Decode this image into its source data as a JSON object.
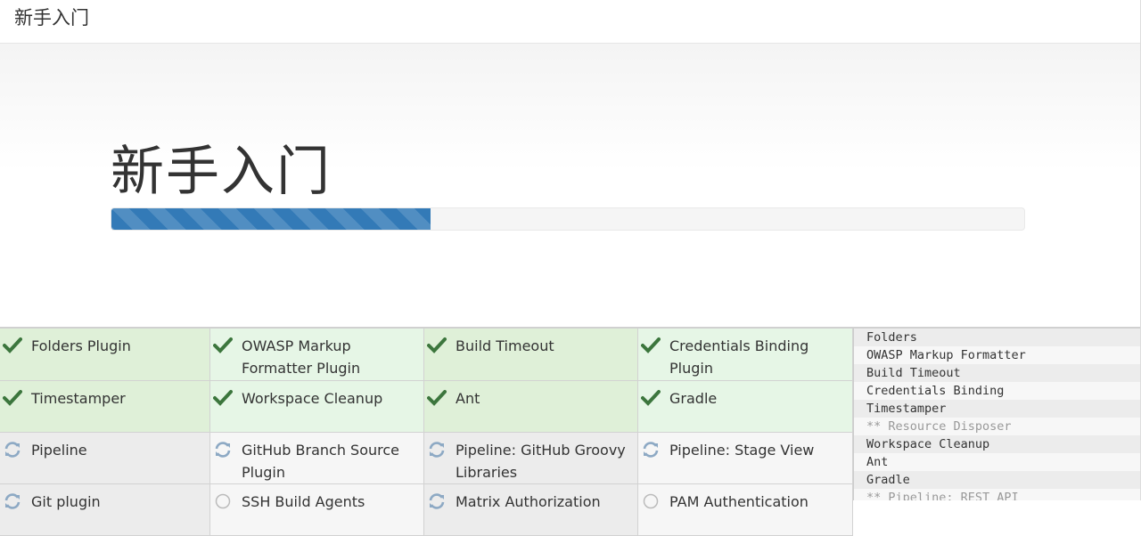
{
  "topbar": {
    "title": "新手入门"
  },
  "hero": {
    "heading": "新手入门",
    "progress_percent": 35
  },
  "colors": {
    "progress": "#337ab7",
    "installed_bg": "#dff0d8",
    "check": "#3c763d",
    "pending_bg": "#ececec",
    "spinner": "#8da9c4"
  },
  "plugins": [
    {
      "name": "Folders Plugin",
      "status": "installed"
    },
    {
      "name": "OWASP Markup Formatter Plugin",
      "status": "installed"
    },
    {
      "name": "Build Timeout",
      "status": "installed"
    },
    {
      "name": "Credentials Binding Plugin",
      "status": "installed"
    },
    {
      "name": "Timestamper",
      "status": "installed"
    },
    {
      "name": "Workspace Cleanup",
      "status": "installed"
    },
    {
      "name": "Ant",
      "status": "installed"
    },
    {
      "name": "Gradle",
      "status": "installed"
    },
    {
      "name": "Pipeline",
      "status": "installing"
    },
    {
      "name": "GitHub Branch Source Plugin",
      "status": "installing"
    },
    {
      "name": "Pipeline: GitHub Groovy Libraries",
      "status": "installing"
    },
    {
      "name": "Pipeline: Stage View",
      "status": "installing"
    },
    {
      "name": "Git plugin",
      "status": "installing"
    },
    {
      "name": "SSH Build Agents",
      "status": "pending"
    },
    {
      "name": "Matrix Authorization",
      "status": "installing"
    },
    {
      "name": "PAM Authentication",
      "status": "pending"
    }
  ],
  "log": [
    "Folders",
    "OWASP Markup Formatter",
    "Build Timeout",
    "Credentials Binding",
    "Timestamper",
    "** Resource Disposer",
    "Workspace Cleanup",
    "Ant",
    "Gradle",
    "** Pipeline: REST API"
  ]
}
